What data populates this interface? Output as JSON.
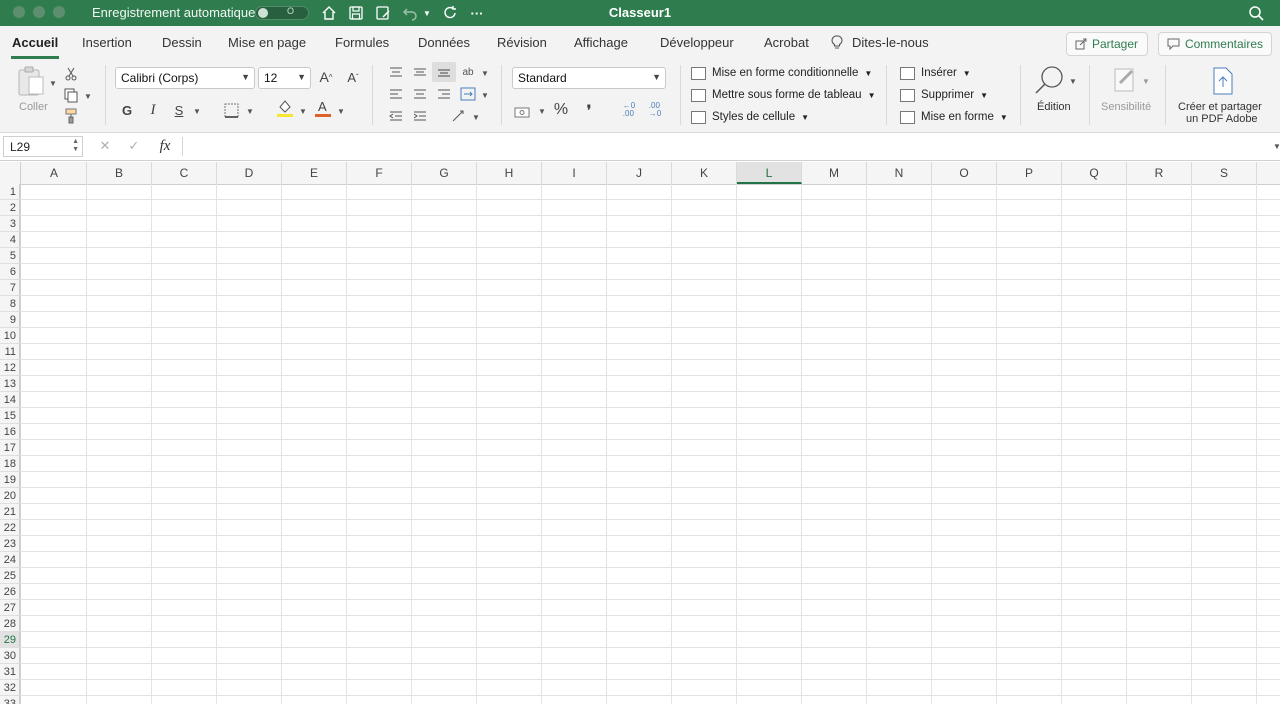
{
  "titlebar": {
    "autosave_label": "Enregistrement automatique",
    "autosave_state": "O",
    "title": "Classeur1"
  },
  "tabs": [
    "Accueil",
    "Insertion",
    "Dessin",
    "Mise en page",
    "Formules",
    "Données",
    "Révision",
    "Affichage",
    "Développeur",
    "Acrobat",
    "Dites-le-nous"
  ],
  "share_button": "Partager",
  "comments_button": "Commentaires",
  "ribbon": {
    "paste_label": "Coller",
    "font_name": "Calibri (Corps)",
    "font_size": "12",
    "bold": "G",
    "italic": "I",
    "underline": "S",
    "grow_font": "A^",
    "shrink_font": "Aˇ",
    "number_format": "Standard",
    "percent": "%",
    "comma": "❜",
    "styles": {
      "conditional": "Mise en forme conditionnelle",
      "as_table": "Mettre sous forme de tableau",
      "cell_styles": "Styles de cellule"
    },
    "cells": {
      "insert": "Insérer",
      "delete": "Supprimer",
      "format": "Mise en forme"
    },
    "editing": "Édition",
    "sensitivity": "Sensibilité",
    "adobe_line1": "Créer et partager",
    "adobe_line2": "un PDF Adobe",
    "colors": {
      "accent": "#2f7d4f",
      "highlight": "#f7e631",
      "font_color": "#e0622b"
    }
  },
  "formula_bar": {
    "cell_ref": "L29",
    "fx": "fx",
    "value": ""
  },
  "sheet": {
    "columns": [
      "A",
      "B",
      "C",
      "D",
      "E",
      "F",
      "G",
      "H",
      "I",
      "J",
      "K",
      "L",
      "M",
      "N",
      "O",
      "P",
      "Q",
      "R",
      "S"
    ],
    "rows": [
      "1",
      "2",
      "3",
      "4",
      "5",
      "6",
      "7",
      "8",
      "9",
      "10",
      "11",
      "12",
      "13",
      "14",
      "15",
      "16",
      "17",
      "18",
      "19",
      "20",
      "21",
      "22",
      "23",
      "24",
      "25",
      "26",
      "27",
      "28",
      "29",
      "30",
      "31",
      "32",
      "33"
    ],
    "selected_column": "L",
    "selected_row": "29"
  }
}
